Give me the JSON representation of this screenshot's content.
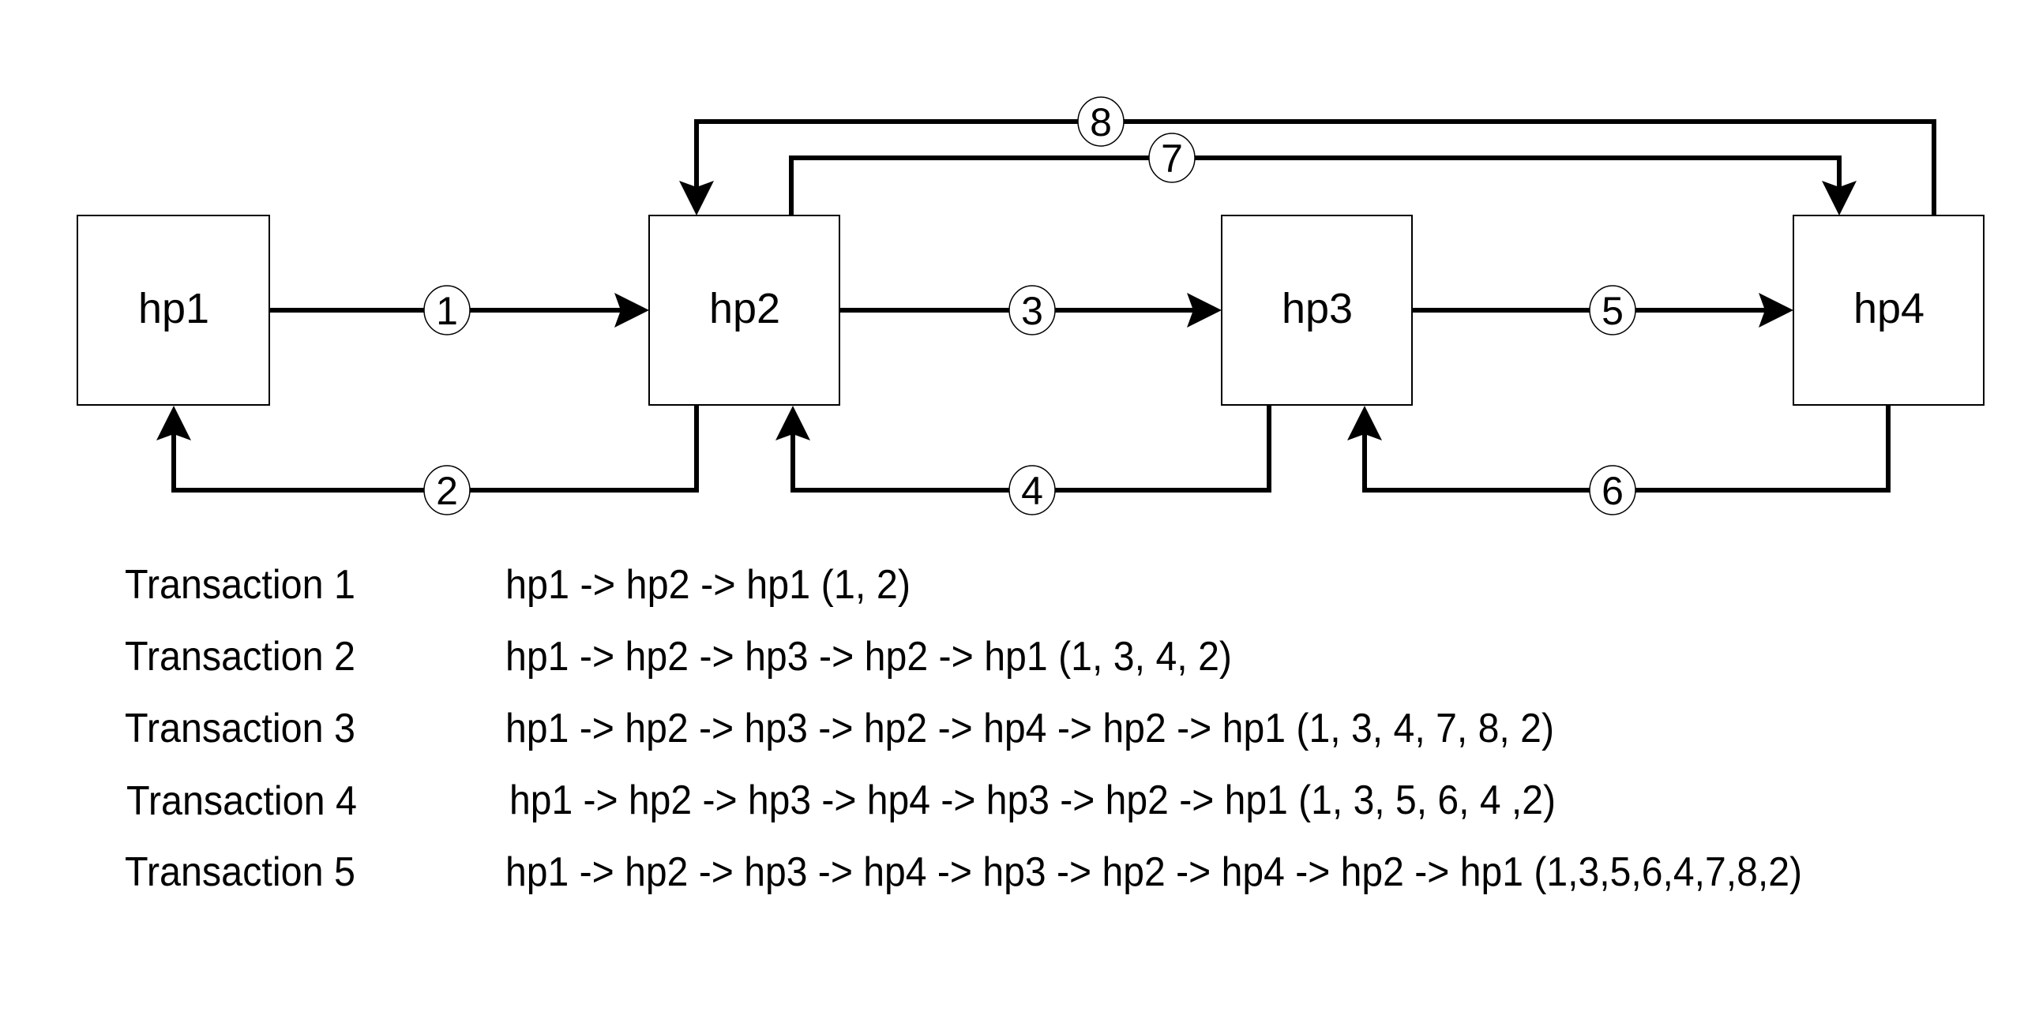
{
  "diagram": {
    "nodes": [
      {
        "id": "hp1",
        "label": "hp1"
      },
      {
        "id": "hp2",
        "label": "hp2"
      },
      {
        "id": "hp3",
        "label": "hp3"
      },
      {
        "id": "hp4",
        "label": "hp4"
      }
    ],
    "edges": [
      {
        "number": "1",
        "from": "hp1",
        "to": "hp2"
      },
      {
        "number": "2",
        "from": "hp2",
        "to": "hp1"
      },
      {
        "number": "3",
        "from": "hp2",
        "to": "hp3"
      },
      {
        "number": "4",
        "from": "hp3",
        "to": "hp2"
      },
      {
        "number": "5",
        "from": "hp3",
        "to": "hp4"
      },
      {
        "number": "6",
        "from": "hp4",
        "to": "hp3"
      },
      {
        "number": "7",
        "from": "hp2",
        "to": "hp4"
      },
      {
        "number": "8",
        "from": "hp4",
        "to": "hp2"
      }
    ]
  },
  "transactions": [
    {
      "label": "Transaction 1",
      "path": "hp1 -> hp2 -> hp1 (1, 2)"
    },
    {
      "label": "Transaction 2",
      "path": "hp1 -> hp2 -> hp3 -> hp2 -> hp1 (1, 3, 4, 2)"
    },
    {
      "label": "Transaction 3",
      "path": "hp1 -> hp2 -> hp3 -> hp2 -> hp4 -> hp2 -> hp1 (1, 3, 4, 7, 8, 2)"
    },
    {
      "label": "Transaction 4",
      "path": "hp1 -> hp2 -> hp3 -> hp4 -> hp3 -> hp2 -> hp1 (1, 3, 5, 6, 4 ,2)"
    },
    {
      "label": "Transaction 5",
      "path": "hp1 -> hp2 -> hp3 -> hp4 -> hp3 -> hp2 -> hp4 -> hp2 -> hp1 (1,3,5,6,4,7,8,2)"
    }
  ]
}
